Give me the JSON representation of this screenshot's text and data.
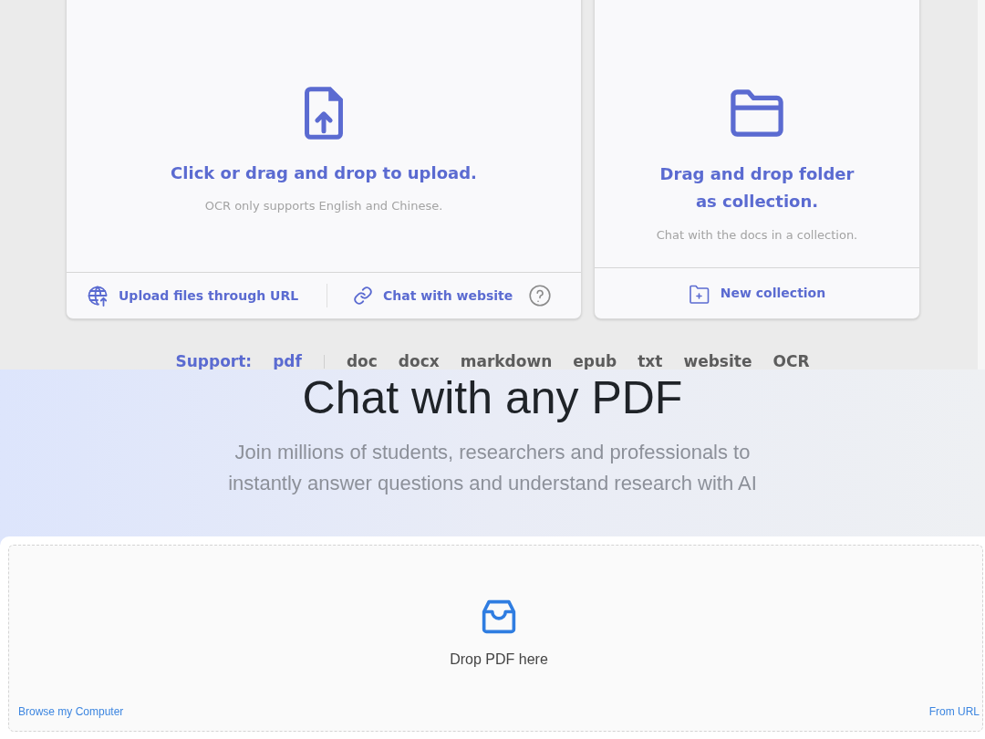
{
  "upload_panel": {
    "heading": "Click or drag and drop to upload.",
    "note": "OCR only supports English and Chinese.",
    "actions": [
      {
        "kind": "url",
        "label": "Upload files through URL"
      },
      {
        "kind": "website",
        "label": "Chat with website"
      }
    ]
  },
  "collection_panel": {
    "heading_lines": [
      "Drag and drop folder",
      "as collection."
    ],
    "note": "Chat with the docs in a collection.",
    "action": {
      "label": "New collection"
    }
  },
  "support": {
    "label": "Support:",
    "formats": [
      {
        "label": "pdf",
        "highlighted": true
      },
      {
        "label": "doc",
        "highlighted": false
      },
      {
        "label": "docx",
        "highlighted": false
      },
      {
        "label": "markdown",
        "highlighted": false
      },
      {
        "label": "epub",
        "highlighted": false
      },
      {
        "label": "txt",
        "highlighted": false
      },
      {
        "label": "website",
        "highlighted": false
      },
      {
        "label": "OCR",
        "highlighted": false
      }
    ]
  },
  "hero": {
    "title": "Chat with any PDF",
    "subtitle": "Join millions of students, researchers and professionals to instantly answer questions and understand research with AI"
  },
  "dropzone": {
    "prompt": "Drop PDF here",
    "links": [
      {
        "label": "Browse my Computer"
      },
      {
        "label": "From URL"
      }
    ]
  }
}
